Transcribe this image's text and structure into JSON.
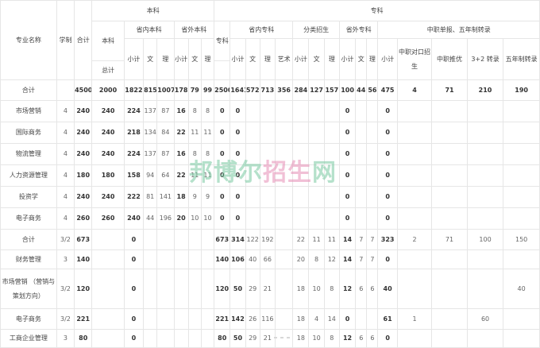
{
  "header": {
    "major": "专业名称",
    "years": "学制",
    "total": "合计",
    "benke": "本科",
    "zhuanke": "专科",
    "benke_zong": "本科",
    "benke_zongji": "总计",
    "in_province_benke": "省内本科",
    "out_province_benke": "省外本科",
    "zhuanke_sub": "专科",
    "in_province_zhuanke": "省内专科",
    "fenlei": "分类招生",
    "out_province_zhuanke": "省外专科",
    "zhongzhi": "中职单报、五年制转录",
    "subtotal": "小计",
    "wen": "文",
    "li": "理",
    "yishu": "艺术",
    "zz_dk": "中职对口招生",
    "zz_tuiyou": "中职推优",
    "sanjia2": "3+2 转录",
    "wunian": "五年制转录"
  },
  "grand_total": [
    "合计",
    "",
    "4500",
    "2000",
    "1822",
    "815",
    "1007",
    "178",
    "79",
    "99",
    "2500",
    "1641",
    "572",
    "713",
    "356",
    "284",
    "127",
    "157",
    "100",
    "44",
    "56",
    "475",
    "4",
    "71",
    "210",
    "190"
  ],
  "rows": [
    [
      "市场营销",
      "4",
      "240",
      "240",
      "224",
      "137",
      "87",
      "16",
      "8",
      "8",
      "0",
      "0",
      "",
      "",
      "",
      "",
      "",
      "",
      "0",
      "",
      "",
      "0",
      "",
      "",
      "",
      ""
    ],
    [
      "国际商务",
      "4",
      "240",
      "240",
      "218",
      "134",
      "84",
      "22",
      "11",
      "11",
      "0",
      "0",
      "",
      "",
      "",
      "",
      "",
      "",
      "0",
      "",
      "",
      "0",
      "",
      "",
      "",
      ""
    ],
    [
      "物流管理",
      "4",
      "240",
      "240",
      "224",
      "137",
      "87",
      "16",
      "8",
      "8",
      "0",
      "0",
      "",
      "",
      "",
      "",
      "",
      "",
      "0",
      "",
      "",
      "0",
      "",
      "",
      "",
      ""
    ],
    [
      "人力资源管理",
      "4",
      "180",
      "180",
      "158",
      "94",
      "64",
      "22",
      "11",
      "11",
      "0",
      "0",
      "",
      "",
      "",
      "",
      "",
      "",
      "0",
      "",
      "",
      "0",
      "",
      "",
      "",
      ""
    ],
    [
      "投资学",
      "4",
      "240",
      "240",
      "222",
      "81",
      "141",
      "18",
      "9",
      "9",
      "0",
      "0",
      "",
      "",
      "",
      "",
      "",
      "",
      "0",
      "",
      "",
      "0",
      "",
      "",
      "",
      ""
    ],
    [
      "电子商务",
      "4",
      "260",
      "260",
      "240",
      "44",
      "196",
      "20",
      "10",
      "10",
      "0",
      "0",
      "",
      "",
      "",
      "",
      "",
      "",
      "0",
      "",
      "",
      "0",
      "",
      "",
      "",
      ""
    ],
    [
      "合计",
      "3/2",
      "673",
      "",
      "0",
      "",
      "",
      "",
      "",
      "",
      "673",
      "314",
      "122",
      "192",
      "",
      "22",
      "11",
      "11",
      "14",
      "7",
      "7",
      "323",
      "2",
      "71",
      "100",
      "150"
    ],
    [
      "财务管理",
      "3",
      "140",
      "",
      "0",
      "",
      "",
      "",
      "",
      "",
      "140",
      "106",
      "40",
      "66",
      "",
      "20",
      "8",
      "12",
      "14",
      "7",
      "7",
      "0",
      "",
      "",
      "",
      ""
    ],
    [
      "市场营销 （营销与策划方向）",
      "3/2",
      "120",
      "",
      "0",
      "",
      "",
      "",
      "",
      "",
      "120",
      "50",
      "29",
      "21",
      "",
      "18",
      "10",
      "8",
      "12",
      "6",
      "6",
      "40",
      "",
      "",
      "",
      "40"
    ],
    [
      "电子商务",
      "3/2",
      "221",
      "",
      "0",
      "",
      "",
      "",
      "",
      "",
      "221",
      "142",
      "26",
      "116",
      "",
      "18",
      "4",
      "14",
      "0",
      "",
      "",
      "61",
      "1",
      "",
      "60",
      ""
    ],
    [
      "工商企业管理",
      "3",
      "80",
      "",
      "0",
      "",
      "",
      "",
      "",
      "",
      "80",
      "50",
      "29",
      "21",
      "",
      "18",
      "10",
      "8",
      "12",
      "6",
      "6",
      "0",
      "",
      "",
      "",
      ""
    ]
  ],
  "watermark": "邦博尔招生网"
}
